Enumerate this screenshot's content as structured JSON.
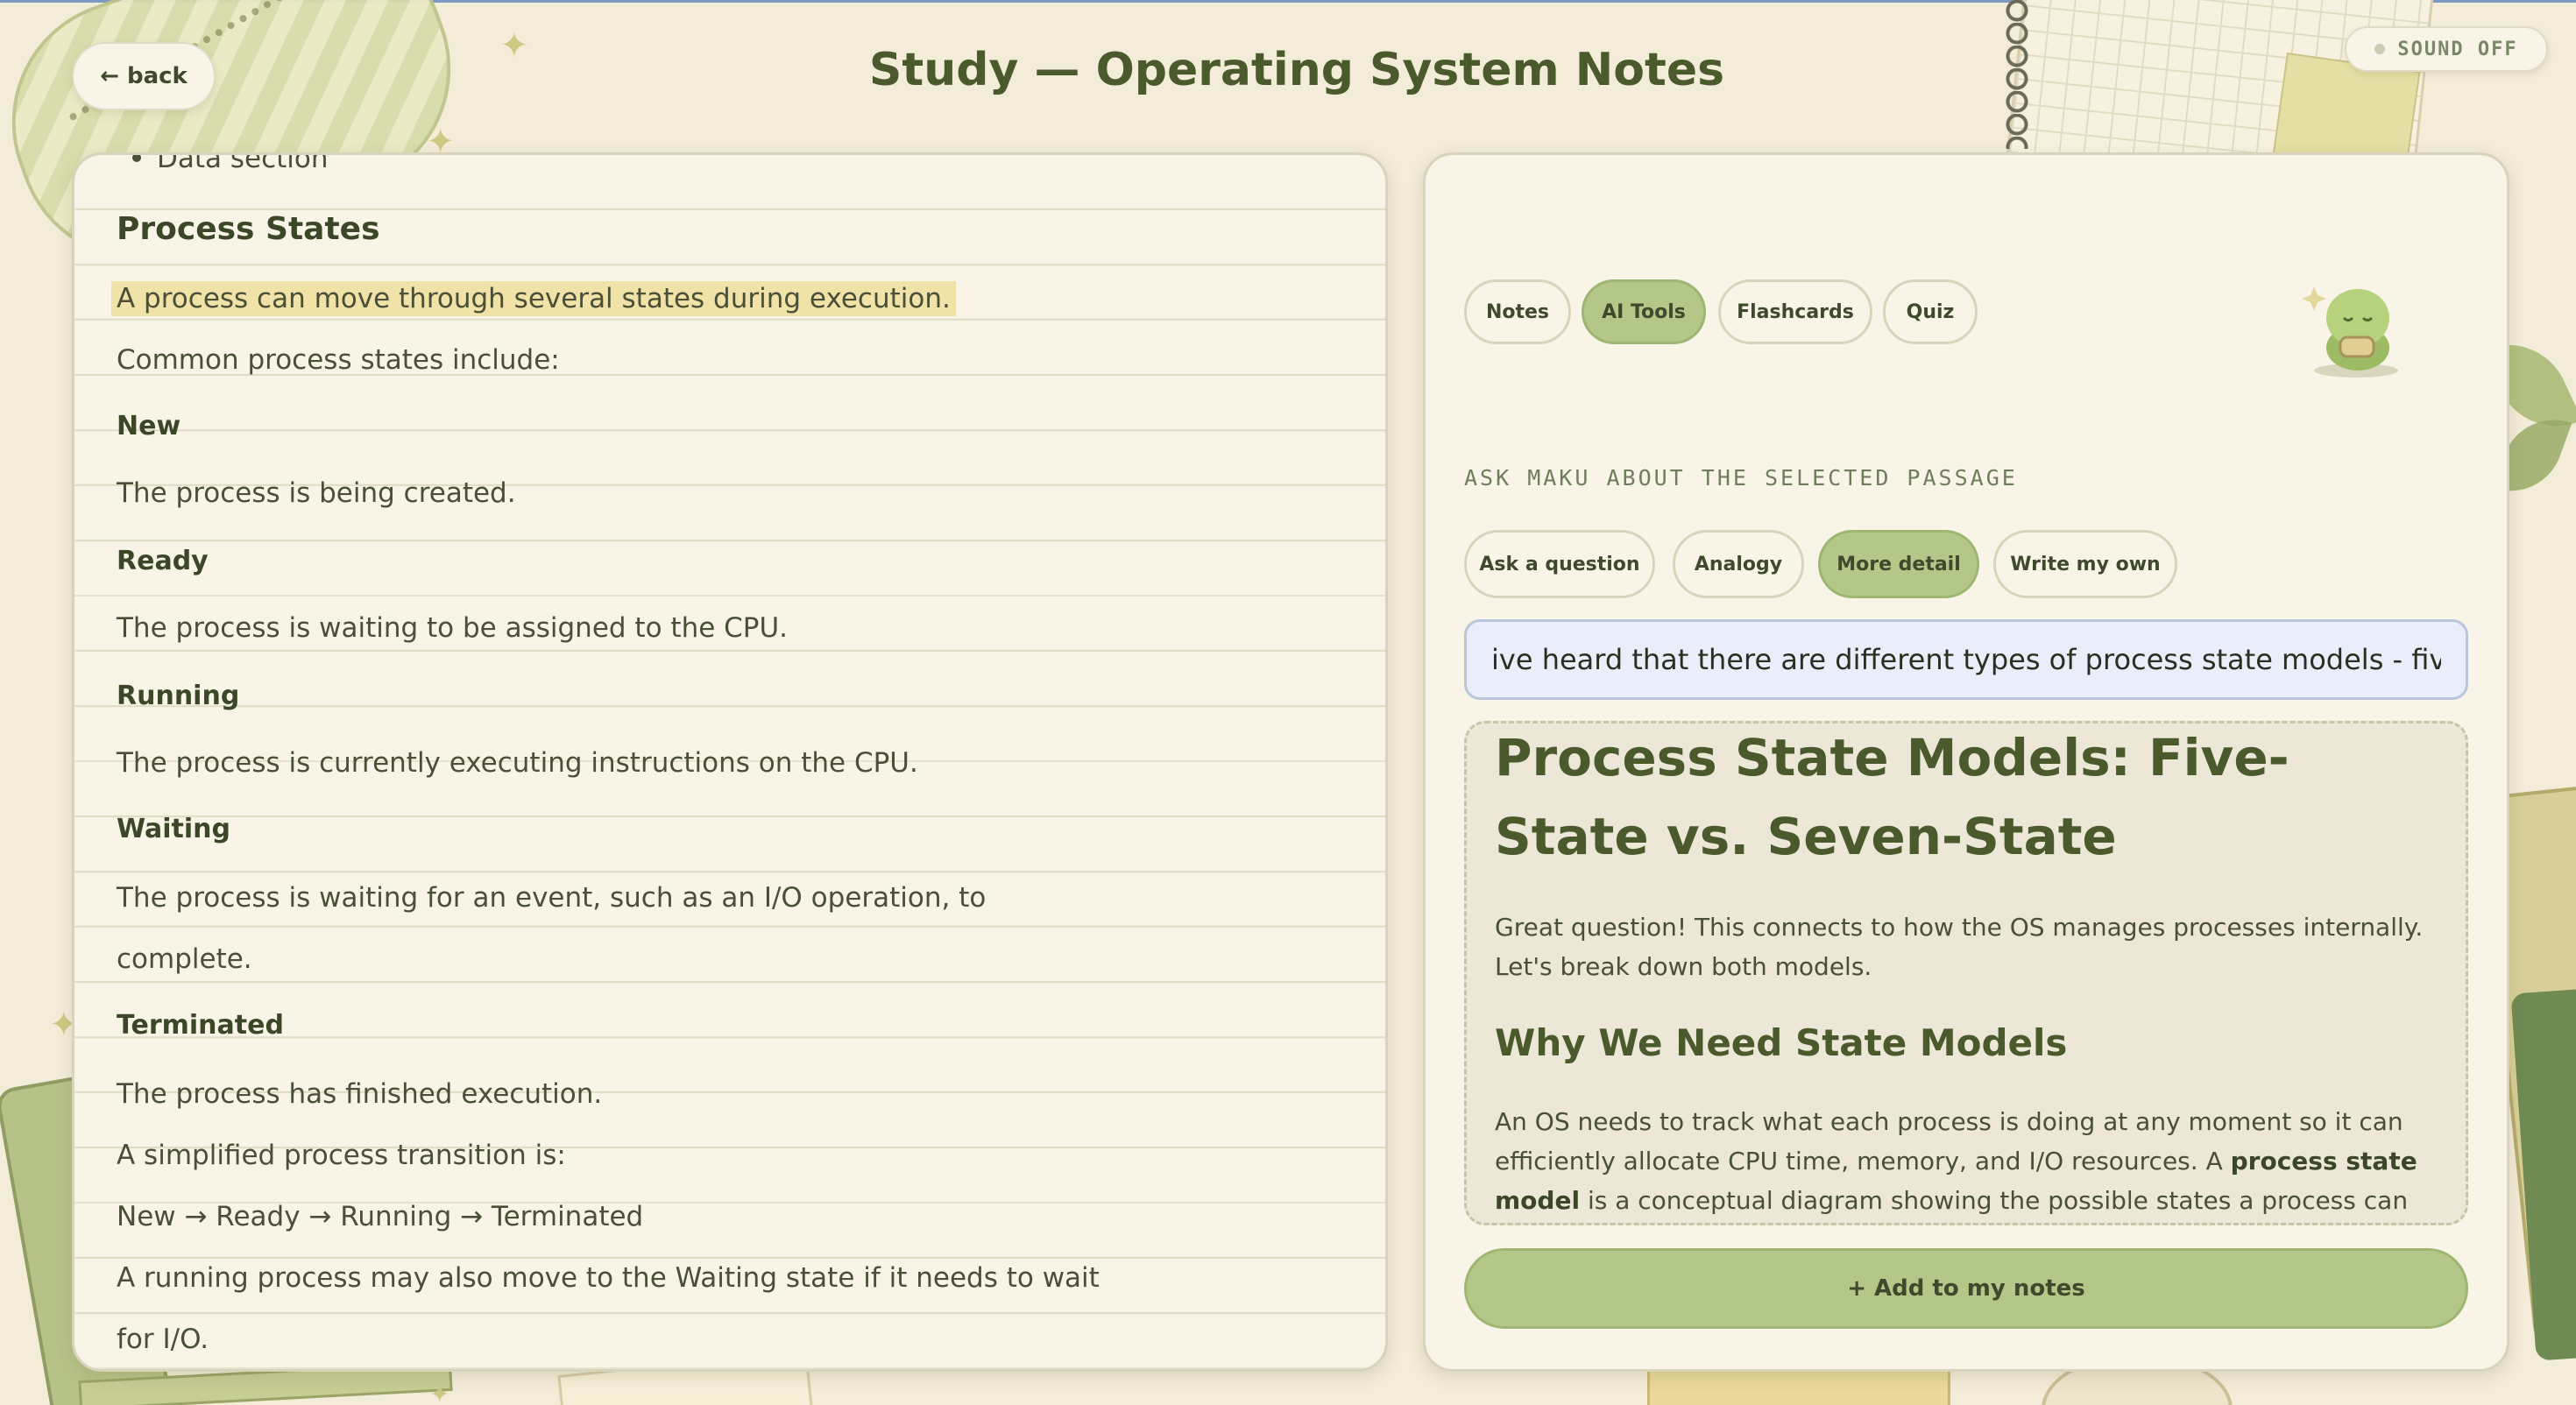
{
  "header": {
    "back_label": "← back",
    "title": "Study — Operating System Notes",
    "sound_label": "SOUND OFF"
  },
  "notes": {
    "lines": [
      "Data section",
      "Process States",
      "A process can move through several states during execution.",
      "Common process states include:",
      "New",
      "The process is being created.",
      "Ready",
      "The process is waiting to be assigned to the CPU.",
      "Running",
      "The process is currently executing instructions on the CPU.",
      "Waiting",
      "The process is waiting for an event, such as an I/O operation, to",
      "complete.",
      "Terminated",
      "The process has finished execution.",
      "A simplified process transition is:",
      "New → Ready → Running → Terminated",
      "A running process may also move to the Waiting state if it needs to wait",
      "for I/O."
    ]
  },
  "tools": {
    "tabs": [
      "Notes",
      "AI Tools",
      "Flashcards",
      "Quiz"
    ],
    "active_tab": "AI Tools",
    "section_label": "ASK MAKU ABOUT THE SELECTED PASSAGE",
    "modes": [
      "Ask a question",
      "Analogy",
      "More detail",
      "Write my own"
    ],
    "active_mode": "More detail",
    "question_value": "ive heard that there are different types of process state models - five state and seven state",
    "answer": {
      "title": "Process State Models: Five-State vs. Seven-State",
      "intro": "Great question! This connects to how the OS manages processes internally. Let's break down both models.",
      "subheading": "Why We Need State Models",
      "body_1": "An OS needs to track what each process is doing at any moment so it can efficiently allocate CPU time, memory, and I/O resources. A ",
      "body_bold_1": "process state",
      "body_2": " ",
      "body_bold_2": "model",
      "body_3": " is a conceptual diagram showing the possible states a process can be in"
    },
    "add_label": "+ Add to my notes"
  },
  "colors": {
    "background": "#f3ecd8",
    "panel": "#f8f5e8",
    "accent_green": "#b3c888",
    "highlight": "#f1e2a8",
    "title_green": "#4a5a2c",
    "input_blue": "#eaeefa"
  },
  "icons": {
    "mascot": "sprout-mascot-icon",
    "sound": "sound-status-dot-icon"
  }
}
